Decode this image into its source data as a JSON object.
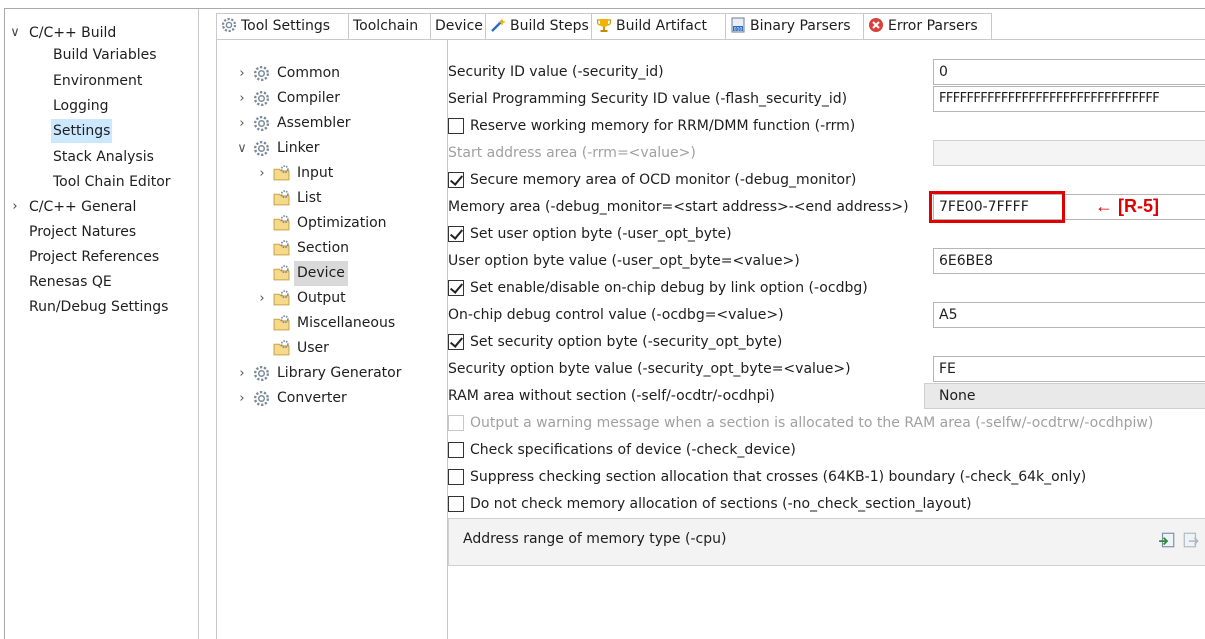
{
  "left_nav": {
    "items": [
      {
        "label": "C/C++ Build",
        "chevron": "down"
      },
      {
        "label": "Build Variables"
      },
      {
        "label": "Environment"
      },
      {
        "label": "Logging"
      },
      {
        "label": "Settings",
        "selected": true
      },
      {
        "label": "Stack Analysis"
      },
      {
        "label": "Tool Chain Editor"
      },
      {
        "label": "C/C++ General",
        "chevron": "right"
      },
      {
        "label": "Project Natures"
      },
      {
        "label": "Project References"
      },
      {
        "label": "Renesas QE"
      },
      {
        "label": "Run/Debug Settings"
      }
    ]
  },
  "tabs": [
    {
      "label": "Tool Settings",
      "icon": "gear-icon",
      "active": true
    },
    {
      "label": "Toolchain"
    },
    {
      "label": "Device"
    },
    {
      "label": "Build Steps",
      "icon": "wand-icon"
    },
    {
      "label": "Build Artifact",
      "icon": "trophy-icon"
    },
    {
      "label": "Binary Parsers",
      "icon": "binary-icon"
    },
    {
      "label": "Error Parsers",
      "icon": "error-icon"
    }
  ],
  "tree": {
    "items": [
      {
        "label": "Common",
        "chevron": "right",
        "icon": "gear-icon"
      },
      {
        "label": "Compiler",
        "chevron": "right",
        "icon": "gear-icon"
      },
      {
        "label": "Assembler",
        "chevron": "right",
        "icon": "gear-icon"
      },
      {
        "label": "Linker",
        "chevron": "down",
        "icon": "gear-icon"
      },
      {
        "label": "Input",
        "chevron": "right",
        "icon": "folder-gear-icon"
      },
      {
        "label": "List",
        "icon": "folder-gear-icon"
      },
      {
        "label": "Optimization",
        "icon": "folder-gear-icon"
      },
      {
        "label": "Section",
        "icon": "folder-gear-icon"
      },
      {
        "label": "Device",
        "icon": "folder-gear-icon",
        "selected": true
      },
      {
        "label": "Output",
        "chevron": "right",
        "icon": "folder-gear-icon"
      },
      {
        "label": "Miscellaneous",
        "icon": "folder-gear-icon"
      },
      {
        "label": "User",
        "icon": "folder-gear-icon"
      },
      {
        "label": "Library Generator",
        "chevron": "right",
        "icon": "gear-icon"
      },
      {
        "label": "Converter",
        "chevron": "right",
        "icon": "gear-icon"
      }
    ]
  },
  "options": {
    "security_id_label": "Security ID value (-security_id)",
    "security_id_value": "0",
    "flash_security_id_label": "Serial Programming Security ID value (-flash_security_id)",
    "flash_security_id_value": "FFFFFFFFFFFFFFFFFFFFFFFFFFFFFFFF",
    "rrm_label": "Reserve working memory for RRM/DMM function (-rrm)",
    "rrm_checked": false,
    "start_address_label": "Start address area (-rrm=<value>)",
    "start_address_value": "",
    "debug_monitor_label": "Secure memory area of OCD monitor (-debug_monitor)",
    "debug_monitor_checked": true,
    "memory_area_label": "Memory area (-debug_monitor=<start address>-<end address>)",
    "memory_area_value": "7FE00-7FFFF",
    "user_opt_byte_label": "Set user option byte (-user_opt_byte)",
    "user_opt_byte_checked": true,
    "user_opt_byte_value_label": "User option byte value (-user_opt_byte=<value>)",
    "user_opt_byte_value": "6E6BE8",
    "ocdbg_label": "Set enable/disable on-chip debug by link option (-ocdbg)",
    "ocdbg_checked": true,
    "ocdbg_value_label": "On-chip debug control value (-ocdbg=<value>)",
    "ocdbg_value": "A5",
    "security_opt_byte_label": "Set security option byte (-security_opt_byte)",
    "security_opt_byte_checked": true,
    "security_opt_byte_value_label": "Security option byte value (-security_opt_byte=<value>)",
    "security_opt_byte_value": "FE",
    "ram_area_label": "RAM area without section (-self/-ocdtr/-ocdhpi)",
    "ram_area_value": "None",
    "warning_label": "Output a warning message when a section is allocated to the RAM area (-selfw/-ocdtrw/-ocdhpiw)",
    "check_device_label": "Check specifications of device (-check_device)",
    "check_64k_label": "Suppress checking section allocation that crosses (64KB-1) boundary (-check_64k_only)",
    "no_check_layout_label": "Do not check memory allocation of sections (-no_check_section_layout)",
    "cpu_group_label": "Address range of memory type (-cpu)"
  },
  "annotation": {
    "text": "← [R-5]",
    "color": "#e00000"
  }
}
